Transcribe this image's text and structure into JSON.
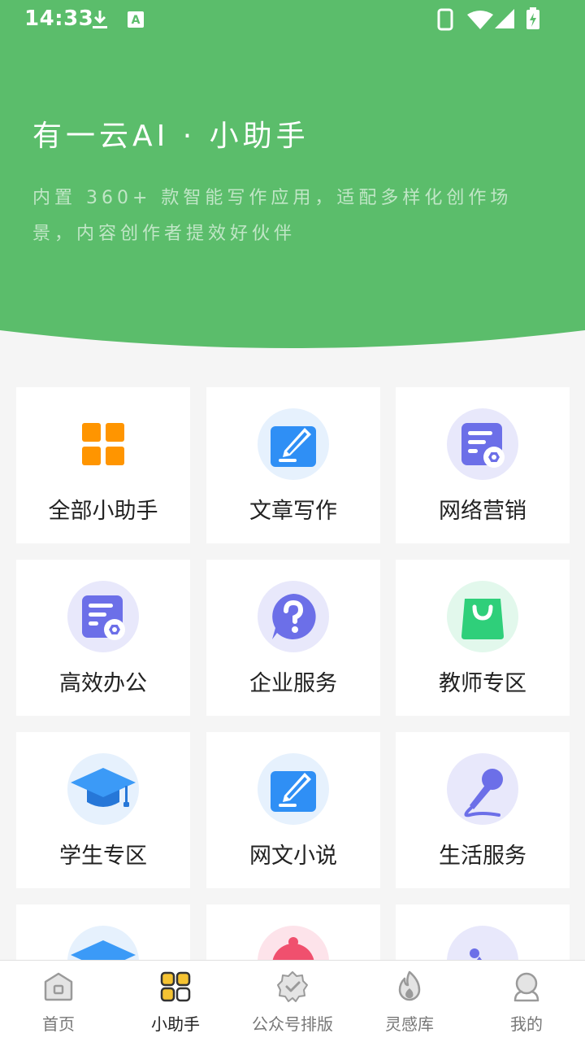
{
  "status_bar": {
    "time": "14:33"
  },
  "hero": {
    "title": "有一云AI · 小助手",
    "description": "内置 360+ 款智能写作应用，适配多样化创作场景，内容创作者提效好伙伴"
  },
  "categories": [
    {
      "label": "全部小助手",
      "icon": "grid-icon"
    },
    {
      "label": "文章写作",
      "icon": "pencil-note-icon"
    },
    {
      "label": "网络营销",
      "icon": "document-gear-icon"
    },
    {
      "label": "高效办公",
      "icon": "document-gear-icon"
    },
    {
      "label": "企业服务",
      "icon": "question-bubble-icon"
    },
    {
      "label": "教师专区",
      "icon": "shopping-bag-icon"
    },
    {
      "label": "学生专区",
      "icon": "graduation-cap-icon"
    },
    {
      "label": "网文小说",
      "icon": "pencil-note-icon"
    },
    {
      "label": "生活服务",
      "icon": "microphone-icon"
    },
    {
      "label": "",
      "icon": "graduation-cap-icon"
    },
    {
      "label": "",
      "icon": "alarm-clock-icon"
    },
    {
      "label": "",
      "icon": "mountain-image-icon"
    }
  ],
  "tabbar": {
    "active_index": 1,
    "items": [
      {
        "label": "首页",
        "icon": "home-icon"
      },
      {
        "label": "小助手",
        "icon": "apps-icon"
      },
      {
        "label": "公众号排版",
        "icon": "badge-check-icon"
      },
      {
        "label": "灵感库",
        "icon": "flame-icon"
      },
      {
        "label": "我的",
        "icon": "profile-icon"
      }
    ]
  },
  "colors": {
    "brand_green": "#5bbd6b",
    "page_background": "#f5f5f5",
    "icon_blue": "#2f8ff5",
    "icon_purple": "#6c6fe8",
    "icon_green": "#2fcf7a",
    "icon_orange": "#ff9500",
    "icon_pink": "#f0506e"
  }
}
